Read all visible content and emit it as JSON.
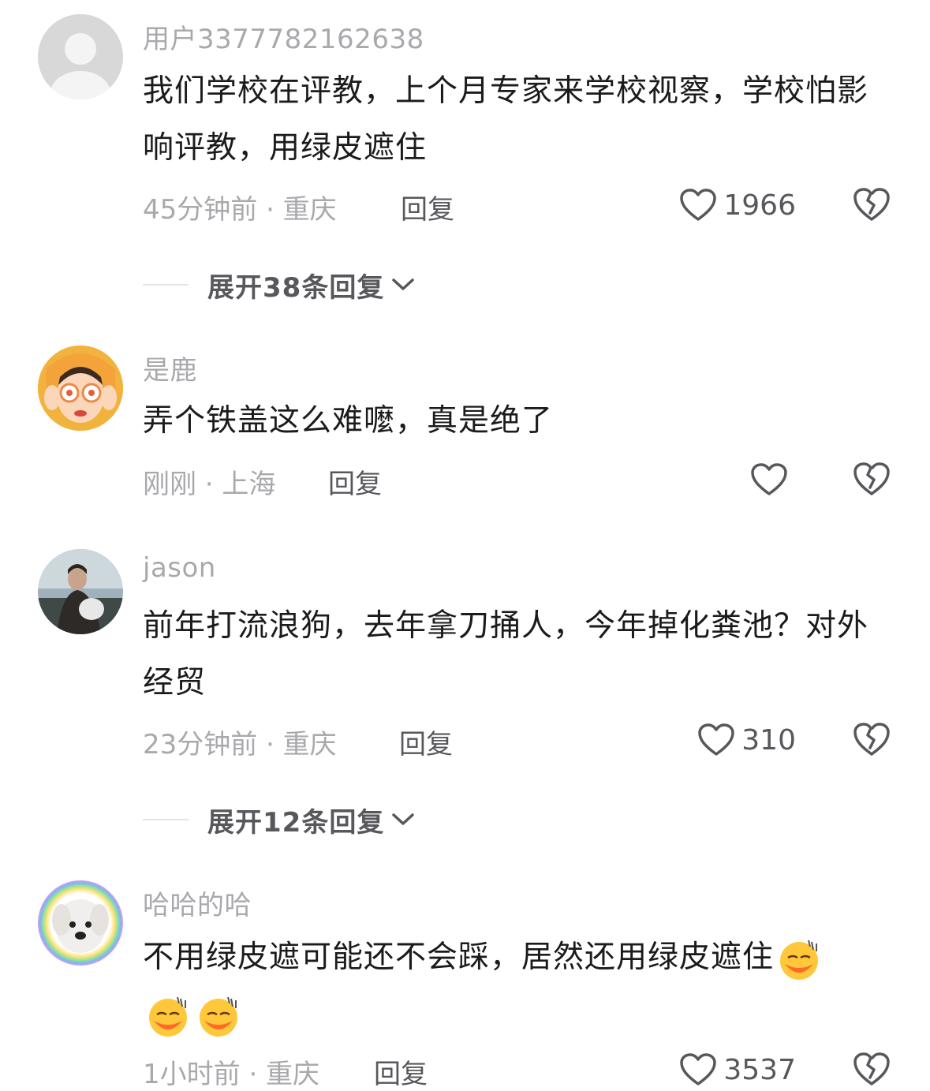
{
  "comments": [
    {
      "username": "用户3377782162638",
      "text": "我们学校在评教，上个月专家来学校视察，学校怕影响评教，用绿皮遮住",
      "meta": "45分钟前 · 重庆",
      "reply_label": "回复",
      "likes": "1966",
      "expand_label": "展开38条回复",
      "avatar_icon": "default-user-avatar"
    },
    {
      "username": "是鹿",
      "text": "弄个铁盖这么难嚒，真是绝了",
      "meta": "刚刚 · 上海",
      "reply_label": "回复",
      "likes": "",
      "avatar_icon": "cartoon-girl-avatar"
    },
    {
      "username": "jason",
      "text": "前年打流浪狗，去年拿刀捅人，今年掉化粪池？对外经贸",
      "meta": "23分钟前 · 重庆",
      "reply_label": "回复",
      "likes": "310",
      "expand_label": "展开12条回复",
      "avatar_icon": "photo-avatar"
    },
    {
      "username": "哈哈的哈",
      "text": "不用绿皮遮可能还不会踩，居然还用绿皮遮住",
      "meta": "1小时前 · 重庆",
      "reply_label": "回复",
      "likes": "3537",
      "avatar_icon": "dog-rainbow-avatar"
    }
  ],
  "icons": {
    "like": "heart-outline-icon",
    "dislike": "broken-heart-icon",
    "expand": "chevron-down-icon",
    "emoji": "sleepy-face-emoji"
  },
  "colors": {
    "username": "#a9a9ad",
    "text": "#1b1b1d",
    "secondary": "#57575c"
  }
}
